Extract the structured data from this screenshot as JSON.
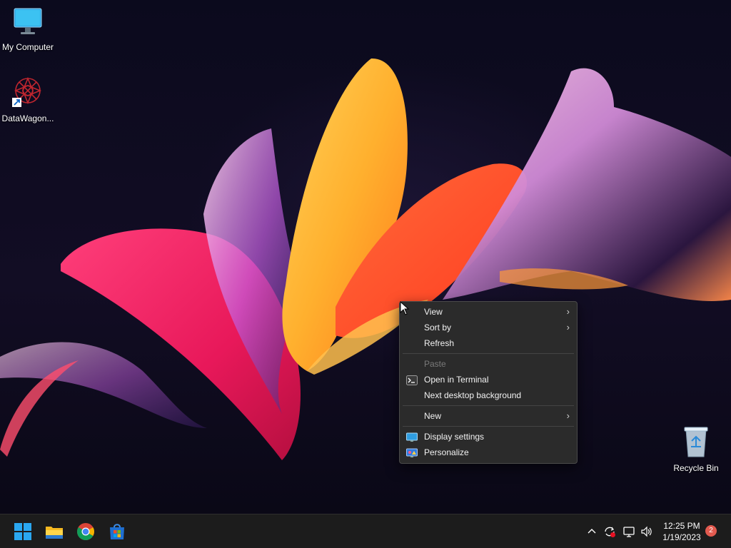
{
  "desktop": {
    "icons": [
      {
        "label": "My Computer",
        "icon": "monitor-icon"
      },
      {
        "label": "DataWagon...",
        "icon": "datawagon-shortcut-icon"
      },
      {
        "label": "Recycle Bin",
        "icon": "recycle-bin-icon"
      }
    ]
  },
  "context_menu": {
    "items": [
      {
        "label": "View",
        "submenu": true
      },
      {
        "label": "Sort by",
        "submenu": true
      },
      {
        "label": "Refresh"
      },
      {
        "label": "Paste",
        "disabled": true
      },
      {
        "label": "Open in Terminal",
        "icon": "terminal-icon"
      },
      {
        "label": "Next desktop background"
      },
      {
        "label": "New",
        "submenu": true
      },
      {
        "label": "Display settings",
        "icon": "display-settings-icon"
      },
      {
        "label": "Personalize",
        "icon": "personalize-icon"
      }
    ]
  },
  "taskbar": {
    "apps": [
      "start-icon",
      "file-explorer-icon",
      "chrome-icon",
      "microsoft-store-icon"
    ],
    "tray_icons": [
      "show-hidden-icons-chevron",
      "sync-error-icon",
      "network-icon",
      "volume-icon"
    ],
    "time": "12:25 PM",
    "date": "1/19/2023",
    "notification_count": "2"
  },
  "colors": {
    "menu_bg": "#2b2b2b",
    "taskbar_bg": "#1c1c1c",
    "badge": "#e25a4f",
    "accent_blue": "#0078d4"
  }
}
